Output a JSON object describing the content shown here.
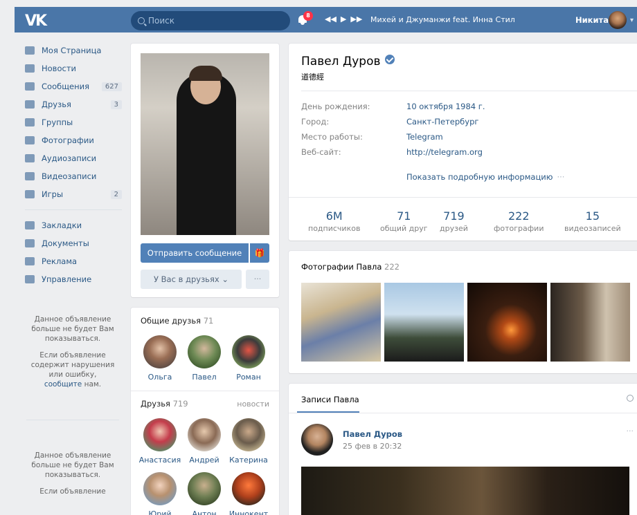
{
  "header": {
    "logo": "VK",
    "search_placeholder": "Поиск",
    "notifications_count": "8",
    "player_prev": "◀◀",
    "player_play": "▶",
    "player_next": "▶▶",
    "track": "Михей и Джуманжи feat. Инна Стил –...",
    "user_name": "Никита",
    "caret": "▾"
  },
  "sidebar": {
    "items": [
      {
        "label": "Моя Страница",
        "icon": "home-icon",
        "count": ""
      },
      {
        "label": "Новости",
        "icon": "news-icon",
        "count": ""
      },
      {
        "label": "Сообщения",
        "icon": "messages-icon",
        "count": "627"
      },
      {
        "label": "Друзья",
        "icon": "friends-icon",
        "count": "3"
      },
      {
        "label": "Группы",
        "icon": "groups-icon",
        "count": ""
      },
      {
        "label": "Фотографии",
        "icon": "camera-icon",
        "count": ""
      },
      {
        "label": "Аудиозаписи",
        "icon": "music-icon",
        "count": ""
      },
      {
        "label": "Видеозаписи",
        "icon": "video-icon",
        "count": ""
      },
      {
        "label": "Игры",
        "icon": "gamepad-icon",
        "count": "2"
      }
    ],
    "items2": [
      {
        "label": "Закладки",
        "icon": "star-icon"
      },
      {
        "label": "Документы",
        "icon": "document-icon"
      },
      {
        "label": "Реклама",
        "icon": "megaphone-icon"
      },
      {
        "label": "Управление",
        "icon": "gamepad-icon"
      }
    ],
    "ad1_text": "Данное объявление больше не будет Вам показываться.",
    "ad1_text2_a": "Если объявление содержит нарушения или ошибку,",
    "ad1_link": "сообщите",
    "ad1_text2_b": "нам.",
    "ad2_text": "Данное объявление больше не будет Вам показываться.",
    "ad2_text2": "Если объявление"
  },
  "profile": {
    "send_message": "Отправить сообщение",
    "gift_icon": "🎁",
    "in_friends": "У Вас в друзьях ⌄",
    "more": "···"
  },
  "common_friends": {
    "title": "Общие друзья",
    "count": "71",
    "items": [
      "Ольга",
      "Павел",
      "Роман"
    ]
  },
  "friends": {
    "title": "Друзья",
    "count": "719",
    "news_link": "новости",
    "items": [
      "Анастасия",
      "Андрей",
      "Катерина",
      "Юрий",
      "Антон",
      "Иннокент"
    ]
  },
  "main": {
    "name": "Павел Дуров",
    "status": "道德經",
    "info": [
      {
        "label": "День рождения:",
        "value": "10 октября 1984 г."
      },
      {
        "label": "Город:",
        "value": "Санкт-Петербург"
      },
      {
        "label": "Место работы:",
        "value": "Telegram"
      },
      {
        "label": "Веб-сайт:",
        "value": "http://telegram.org"
      }
    ],
    "show_more": "Показать подробную информацию",
    "show_more_dots": "···",
    "stats": [
      {
        "value": "6M",
        "label": "подписчиков"
      },
      {
        "value": "71",
        "label": "общий друг"
      },
      {
        "value": "719",
        "label": "друзей"
      },
      {
        "value": "222",
        "label": "фотографии"
      },
      {
        "value": "15",
        "label": "видеозаписей"
      }
    ]
  },
  "photos": {
    "title": "Фотографии Павла",
    "count": "222"
  },
  "wall": {
    "title": "Записи Павла",
    "post_author": "Павел Дуров",
    "post_date": "25 фев в 20:32",
    "post_dots": "···"
  },
  "colors": {
    "header": "#4a76a8",
    "link": "#2a5885",
    "button": "#5181b8"
  }
}
